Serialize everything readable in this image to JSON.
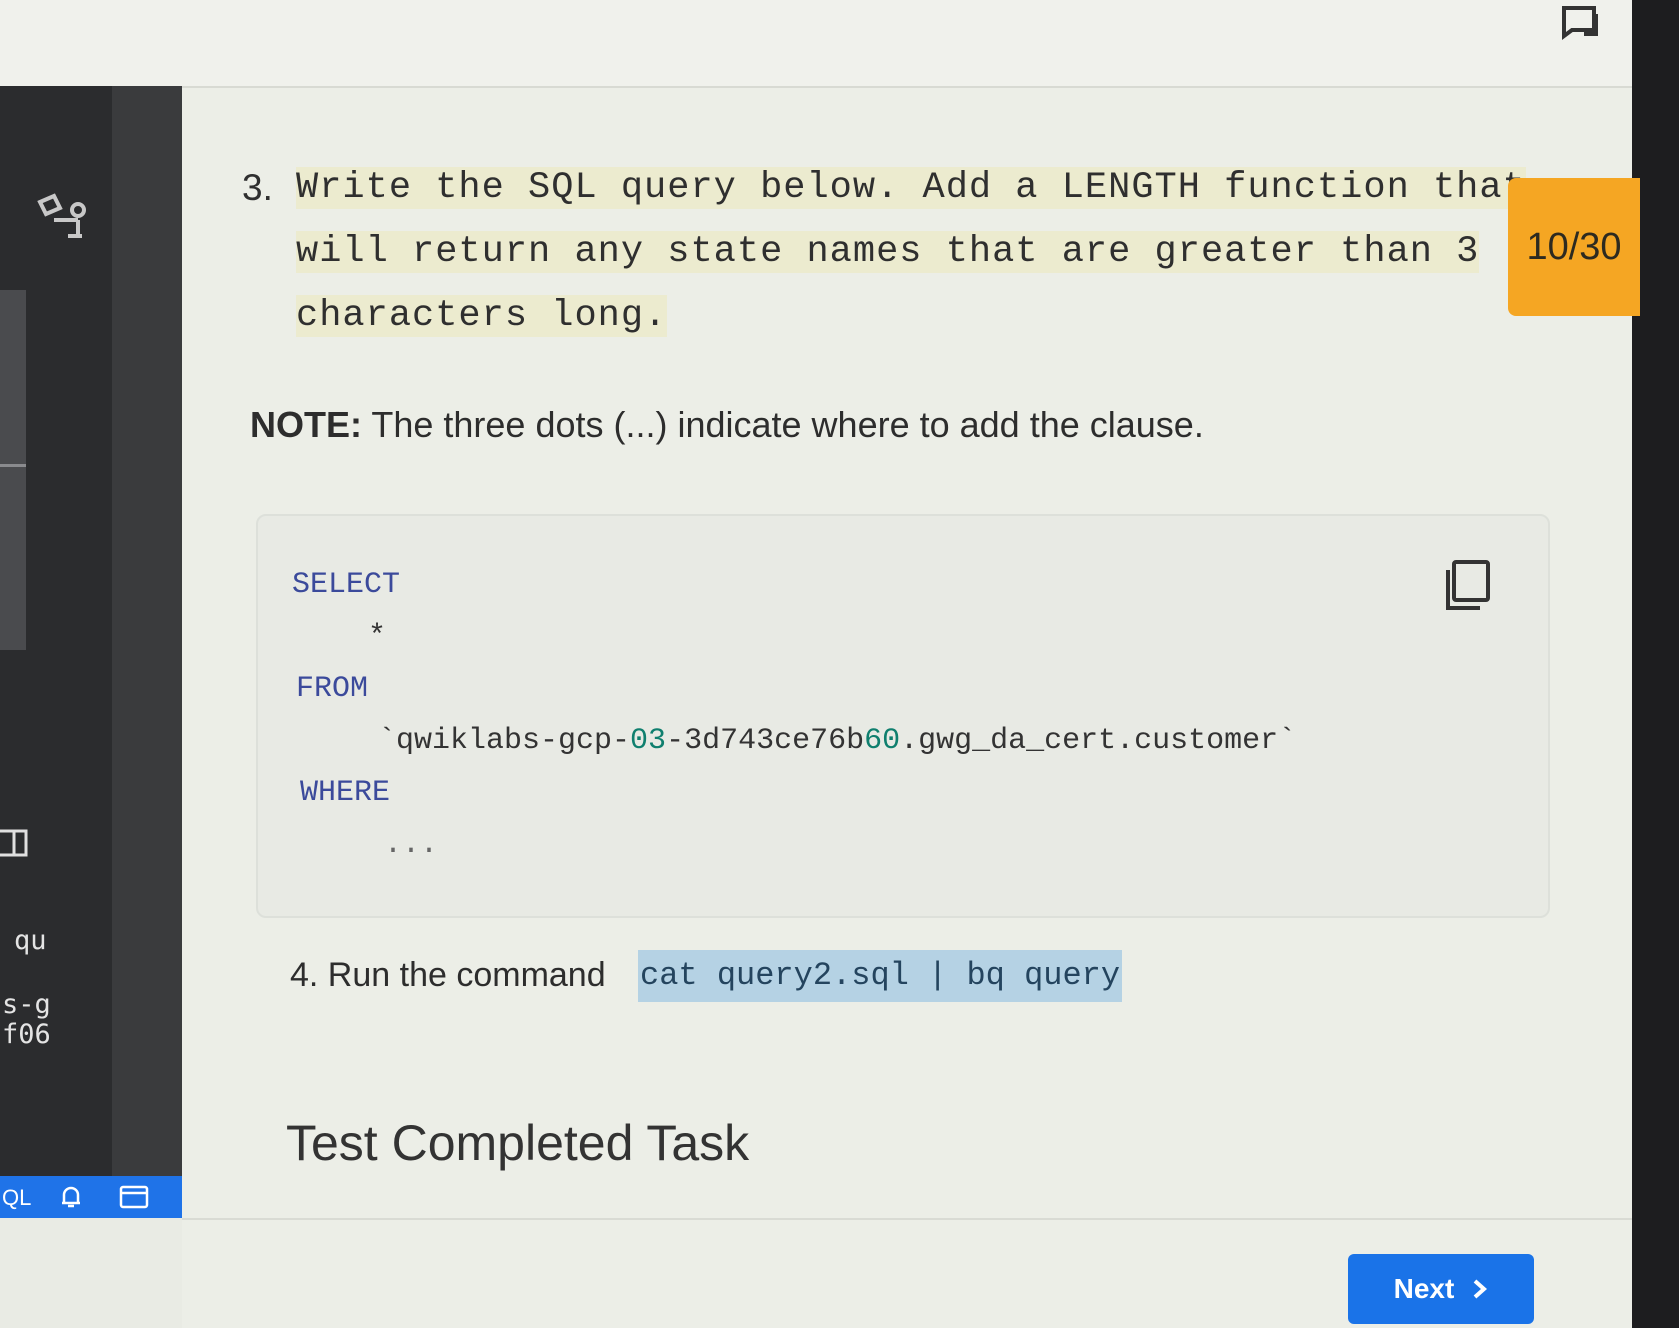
{
  "step3": {
    "number": "3.",
    "text": "Write the SQL query below. Add a LENGTH function that will return any state names that are greater than 3 characters long."
  },
  "progress_badge": "10/30",
  "note": {
    "label": "NOTE:",
    "text": " The three dots (...) indicate where to add the clause."
  },
  "code": {
    "select": "SELECT",
    "star": "*",
    "from": "FROM",
    "table_prefix": "`qwiklabs-gcp-",
    "table_num1": "03",
    "table_mid": "-3d743ce76b",
    "table_num2": "60",
    "table_suffix": ".gwg_da_cert.customer`",
    "where": "WHERE",
    "dots": "..."
  },
  "step4": {
    "text": "4. Run the command",
    "command": "cat query2.sql | bq query"
  },
  "section_title": "Test Completed Task",
  "next_button": "Next",
  "sidebar": {
    "text1": "qu",
    "text2": "s-g",
    "text3": "f06",
    "status_label": "QL"
  },
  "colors": {
    "accent": "#1a73e8",
    "badge": "#f5a623",
    "command_highlight": "#b5d2e4"
  }
}
